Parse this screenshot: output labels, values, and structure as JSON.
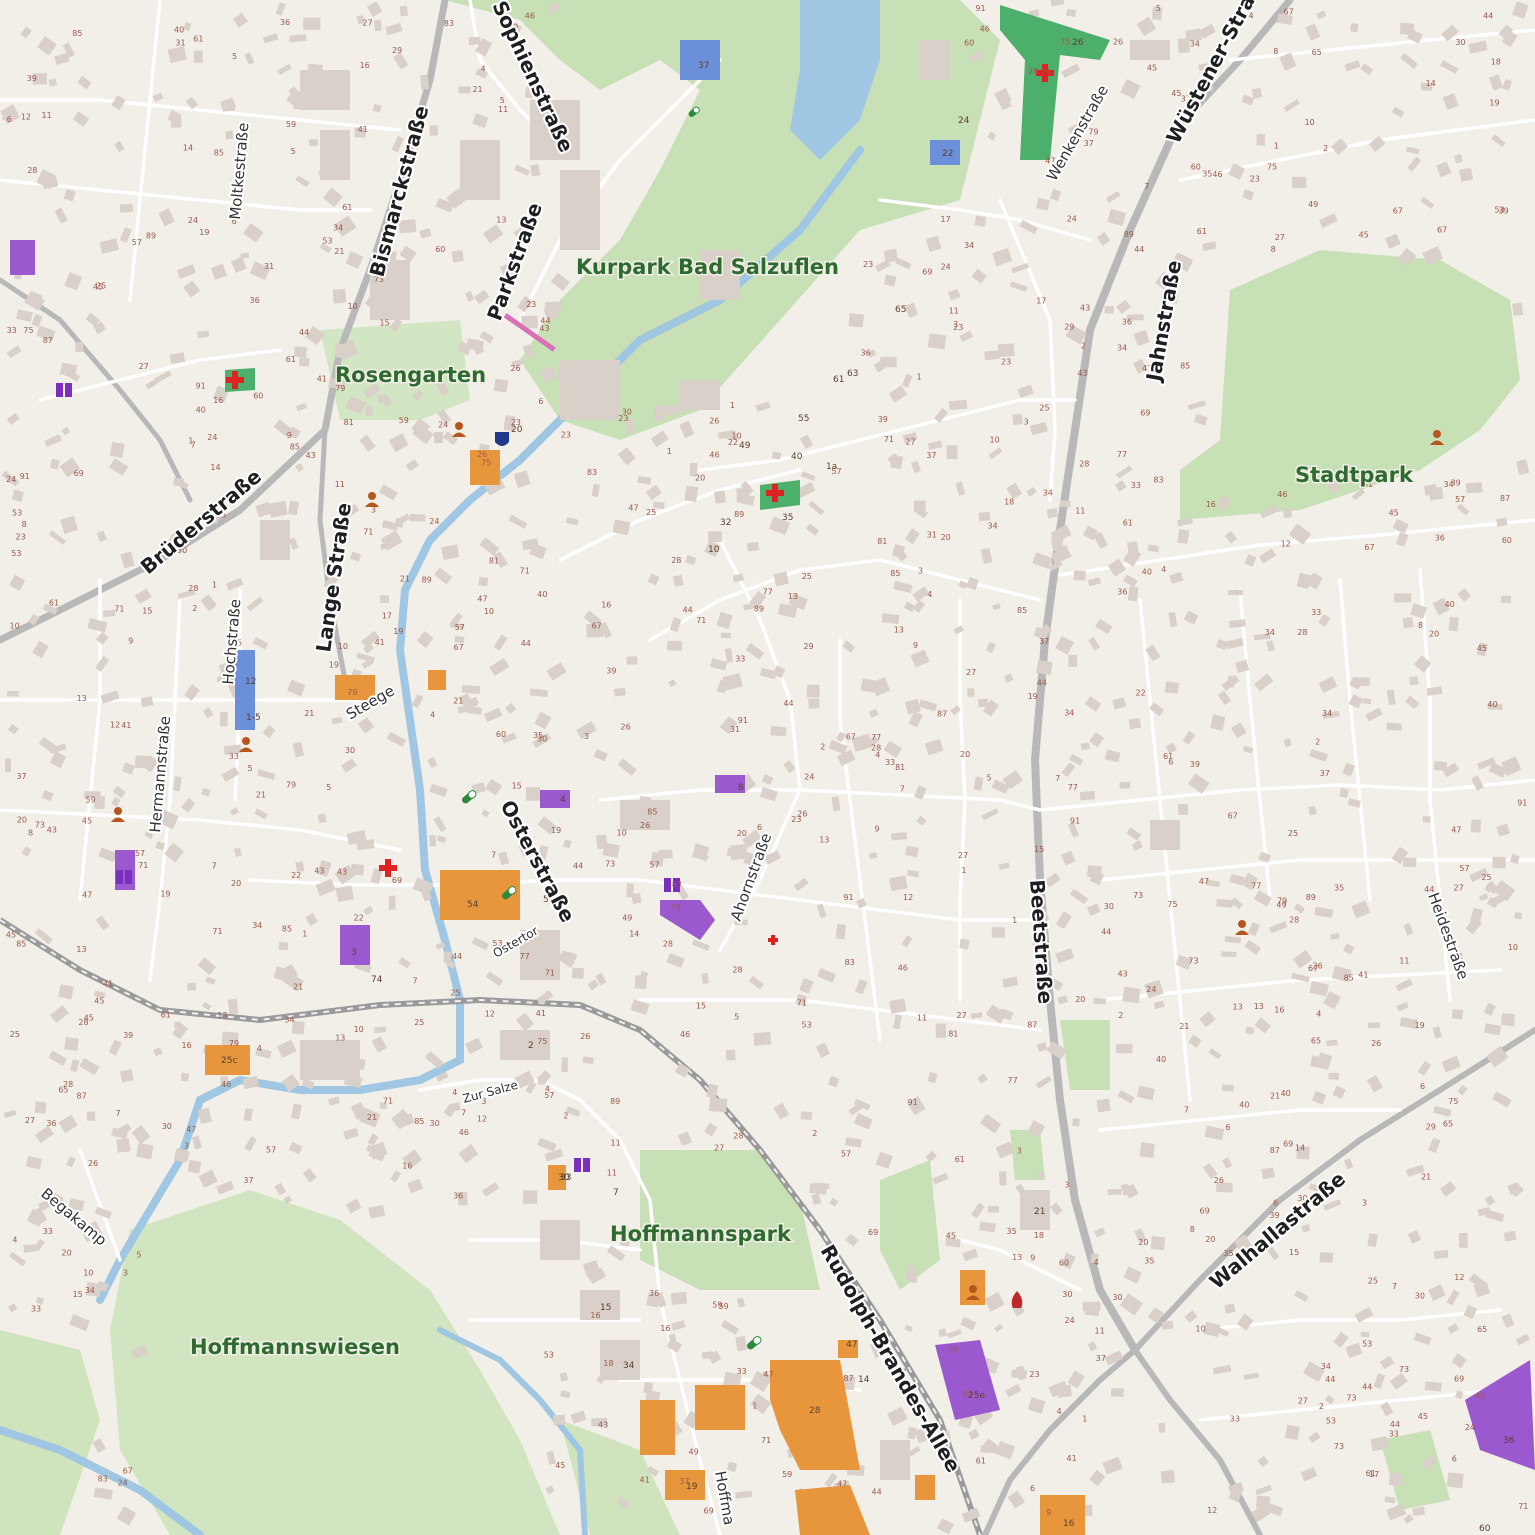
{
  "colors": {
    "background": "#f2efe9",
    "park": "#c8e0b6",
    "water": "#9fc6e2",
    "major_road": "#b3b3b3",
    "minor_road": "#ffffff",
    "building": "#d9d0c9",
    "commercial": "#e8963c",
    "school": "#9b59d0",
    "hospital": "#4caf6c",
    "hospital_cross": "#d22",
    "park_label": "#2e6b2e"
  },
  "streets": [
    {
      "id": "bismarck",
      "label": "Bismarckstraße"
    },
    {
      "id": "parkstrasse",
      "label": "Parkstraße"
    },
    {
      "id": "sophien",
      "label": "Sophienstraße"
    },
    {
      "id": "brueder",
      "label": "Brüderstraße"
    },
    {
      "id": "lange",
      "label": "Lange Straße"
    },
    {
      "id": "oster",
      "label": "Osterstraße"
    },
    {
      "id": "beet",
      "label": "Beetstraße"
    },
    {
      "id": "wuestener",
      "label": "Wüstener-Straße"
    },
    {
      "id": "jahn",
      "label": "Jahnstraße"
    },
    {
      "id": "walhalla",
      "label": "Walhallastraße"
    },
    {
      "id": "rudolph",
      "label": "Rudolph-Brandes-Allee"
    },
    {
      "id": "moltke",
      "label": "Moltkestraße"
    },
    {
      "id": "hochstr",
      "label": "Hochstraße"
    },
    {
      "id": "hermann",
      "label": "Hermannstraße"
    },
    {
      "id": "ahorn",
      "label": "Ahornstraße"
    },
    {
      "id": "heide",
      "label": "Heidestraße"
    },
    {
      "id": "wenken",
      "label": "Wenkenstraße"
    },
    {
      "id": "steege",
      "label": "Steege"
    },
    {
      "id": "ostertor",
      "label": "Ostertor"
    },
    {
      "id": "zursalze",
      "label": "Zur Salze"
    },
    {
      "id": "begakamp",
      "label": "Begakamp"
    },
    {
      "id": "hoffmann",
      "label": "Hoffma"
    }
  ],
  "parks": [
    {
      "id": "kurpark",
      "label": "Kurpark Bad Salzuflen"
    },
    {
      "id": "rosengarten",
      "label": "Rosengarten"
    },
    {
      "id": "stadtpark",
      "label": "Stadtpark"
    },
    {
      "id": "hoffmannspark",
      "label": "Hoffmannspark"
    },
    {
      "id": "hoffmannswiesen",
      "label": "Hoffmannswiesen"
    }
  ],
  "house_numbers": [
    "53",
    "46",
    "33",
    "26",
    "29",
    "22",
    "2",
    "4",
    "14",
    "5",
    "28",
    "20",
    "25",
    "17",
    "13",
    "15",
    "37",
    "49",
    "41",
    "24",
    "30",
    "44",
    "19",
    "35",
    "45",
    "36",
    "23",
    "16",
    "60",
    "12",
    "6",
    "10",
    "3",
    "7",
    "9",
    "11",
    "1",
    "8",
    "21",
    "31",
    "40",
    "18",
    "27",
    "34",
    "39",
    "43",
    "47",
    "57",
    "59",
    "61",
    "65",
    "67",
    "69",
    "71",
    "73",
    "75",
    "77",
    "79",
    "81",
    "83",
    "85",
    "87",
    "89",
    "91"
  ],
  "poi_labels": [
    "37",
    "22",
    "20",
    "65",
    "49",
    "55",
    "61",
    "63",
    "40",
    "1a",
    "35",
    "26",
    "24",
    "32",
    "10",
    "4",
    "8",
    "54",
    "56",
    "3",
    "74",
    "1-5",
    "12",
    "2",
    "7",
    "30",
    "15",
    "34",
    "28",
    "19",
    "25e",
    "36",
    "33",
    "21",
    "47",
    "14",
    "16",
    "60",
    "25c"
  ]
}
